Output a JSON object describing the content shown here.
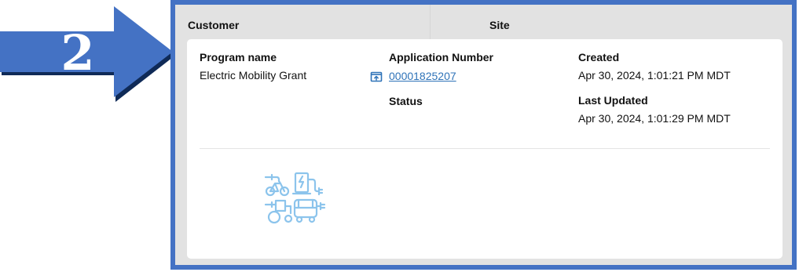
{
  "step_badge": {
    "number": "2",
    "color": "#4472c4"
  },
  "header": {
    "customer_label": "Customer",
    "site_label": "Site"
  },
  "record": {
    "program_name_label": "Program name",
    "program_name_value": "Electric Mobility Grant",
    "application_number_label": "Application Number",
    "application_number_value": "00001825207",
    "status_label": "Status",
    "created_label": "Created",
    "created_value": "Apr 30, 2024, 1:01:21 PM MDT",
    "last_updated_label": "Last Updated",
    "last_updated_value": "Apr 30, 2024, 1:01:29 PM MDT"
  },
  "icons": {
    "record_link": "open-record-icon",
    "program_logo": "electric-mobility-logo"
  },
  "colors": {
    "frame_border": "#4472c4",
    "link": "#2f73b8",
    "logo": "#8cc4ec"
  }
}
